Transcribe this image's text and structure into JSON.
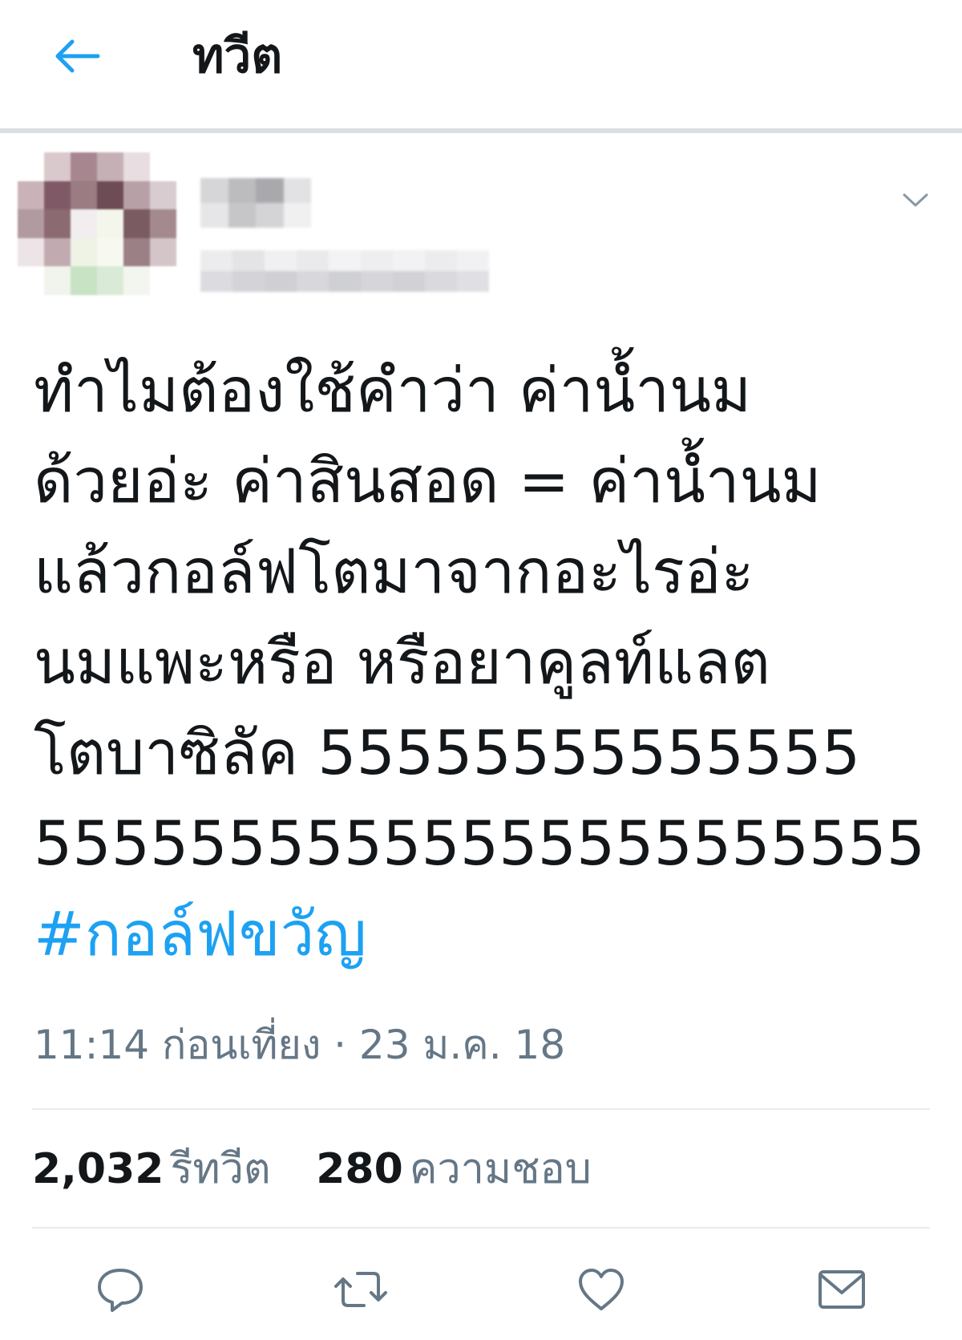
{
  "header": {
    "title": "ทวีต",
    "back_icon": "arrow-left-icon"
  },
  "colors": {
    "accent": "#1da1f2",
    "text": "#14171a",
    "secondary": "#657786",
    "divider": "#e6ecf0"
  },
  "tweet": {
    "menu_icon": "chevron-down-icon",
    "text_lines": [
      "ทำไมต้องใช้คำว่า ค่าน้ำนม",
      "ด้วยอ่ะ ค่าสินสอด = ค่าน้ำนม",
      "แล้วกอล์ฟโตมาจากอะไรอ่ะ",
      "นมแพะหรือ หรือยาคูลท์แลต",
      "โตบาซิลัค 55555555555555",
      "55555555555555555555555"
    ],
    "hashtag": "#กอล์ฟขวัญ",
    "timestamp": "11:14 ก่อนเที่ยง · 23 ม.ค. 18"
  },
  "stats": {
    "retweets_count": "2,032",
    "retweets_label": "รีทวีต",
    "likes_count": "280",
    "likes_label": "ความชอบ"
  },
  "actions": {
    "reply_icon": "reply-icon",
    "retweet_icon": "retweet-icon",
    "like_icon": "heart-icon",
    "share_icon": "mail-icon"
  }
}
